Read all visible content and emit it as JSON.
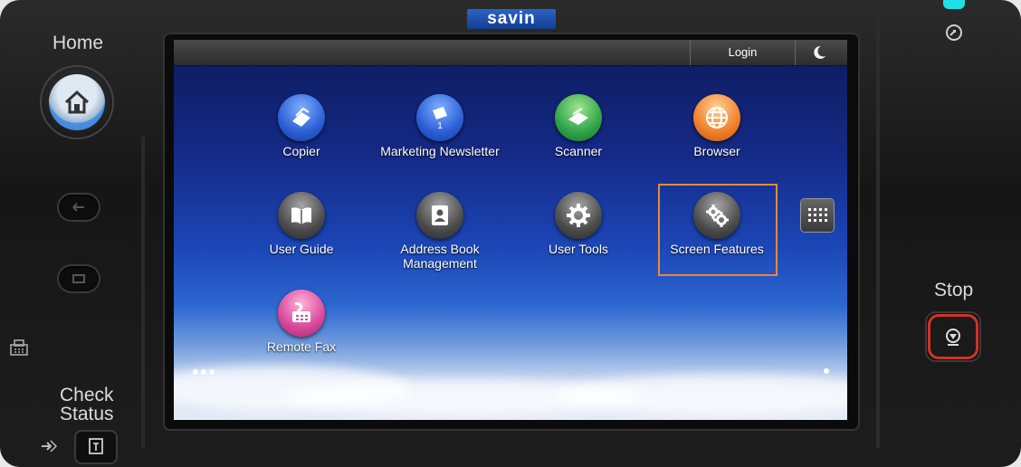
{
  "device": {
    "brand": "savin",
    "home_label": "Home",
    "check_status_label_line1": "Check",
    "check_status_label_line2": "Status",
    "stop_label": "Stop"
  },
  "topbar": {
    "login_label": "Login",
    "sleep_icon": "moon-icon"
  },
  "apps": [
    {
      "label": "Copier",
      "icon": "copier-icon",
      "color": "#2a5fd6"
    },
    {
      "label": "Marketing Newsletter",
      "badge": "1",
      "icon": "document-icon",
      "color": "#2a5fd6"
    },
    {
      "label": "Scanner",
      "icon": "scanner-icon",
      "color": "#2fa34a"
    },
    {
      "label": "Browser",
      "icon": "globe-icon",
      "color": "#f07f27"
    },
    {
      "label": "User Guide",
      "icon": "book-icon",
      "color": "#4b4b4b"
    },
    {
      "label_line1": "Address Book",
      "label_line2": "Management",
      "icon": "address-book-icon",
      "color": "#4b4b4b"
    },
    {
      "label": "User Tools",
      "icon": "gear-icon",
      "color": "#4b4b4b"
    },
    {
      "label": "Screen Features",
      "icon": "gears-icon",
      "color": "#4b4b4b",
      "selected": true
    },
    {
      "label": "Remote Fax",
      "icon": "fax-icon",
      "color": "#d9479a"
    }
  ],
  "colors": {
    "highlight": "#e8893a",
    "stop_ring": "#d23226",
    "home_ring": "#2f7fd8",
    "led": "#1fe0e6"
  }
}
